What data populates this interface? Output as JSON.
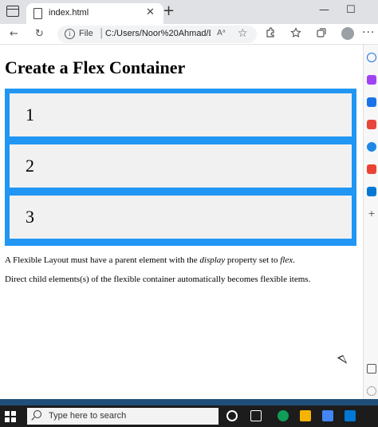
{
  "browser": {
    "tab_title": "index.html",
    "tab_close": "✕",
    "new_tab": "+",
    "win_minimize": "—",
    "win_maximize": "☐",
    "address_scheme": "File",
    "address_sep": "|",
    "address_url": "C:/Users/Noor%20Ahmad/De...",
    "read_aloud": "Aᵃ",
    "favorite": "☆",
    "more": "···",
    "back_icon": "←",
    "refresh_icon": "↻",
    "info_icon": "i"
  },
  "page": {
    "heading": "Create a Flex Container",
    "flex_items": [
      "1",
      "2",
      "3"
    ],
    "paragraph1_before": "A Flexible Layout must have a parent element with the ",
    "paragraph1_em1": "display",
    "paragraph1_mid": " property set to ",
    "paragraph1_em2": "flex",
    "paragraph1_after": ".",
    "paragraph2": "Direct child elements(s) of the flexible container automatically becomes flexible items."
  },
  "taskbar": {
    "search_placeholder": "Type here to search"
  },
  "colors": {
    "flex_container": "#2196f3",
    "flex_item": "#f1f1f1"
  }
}
